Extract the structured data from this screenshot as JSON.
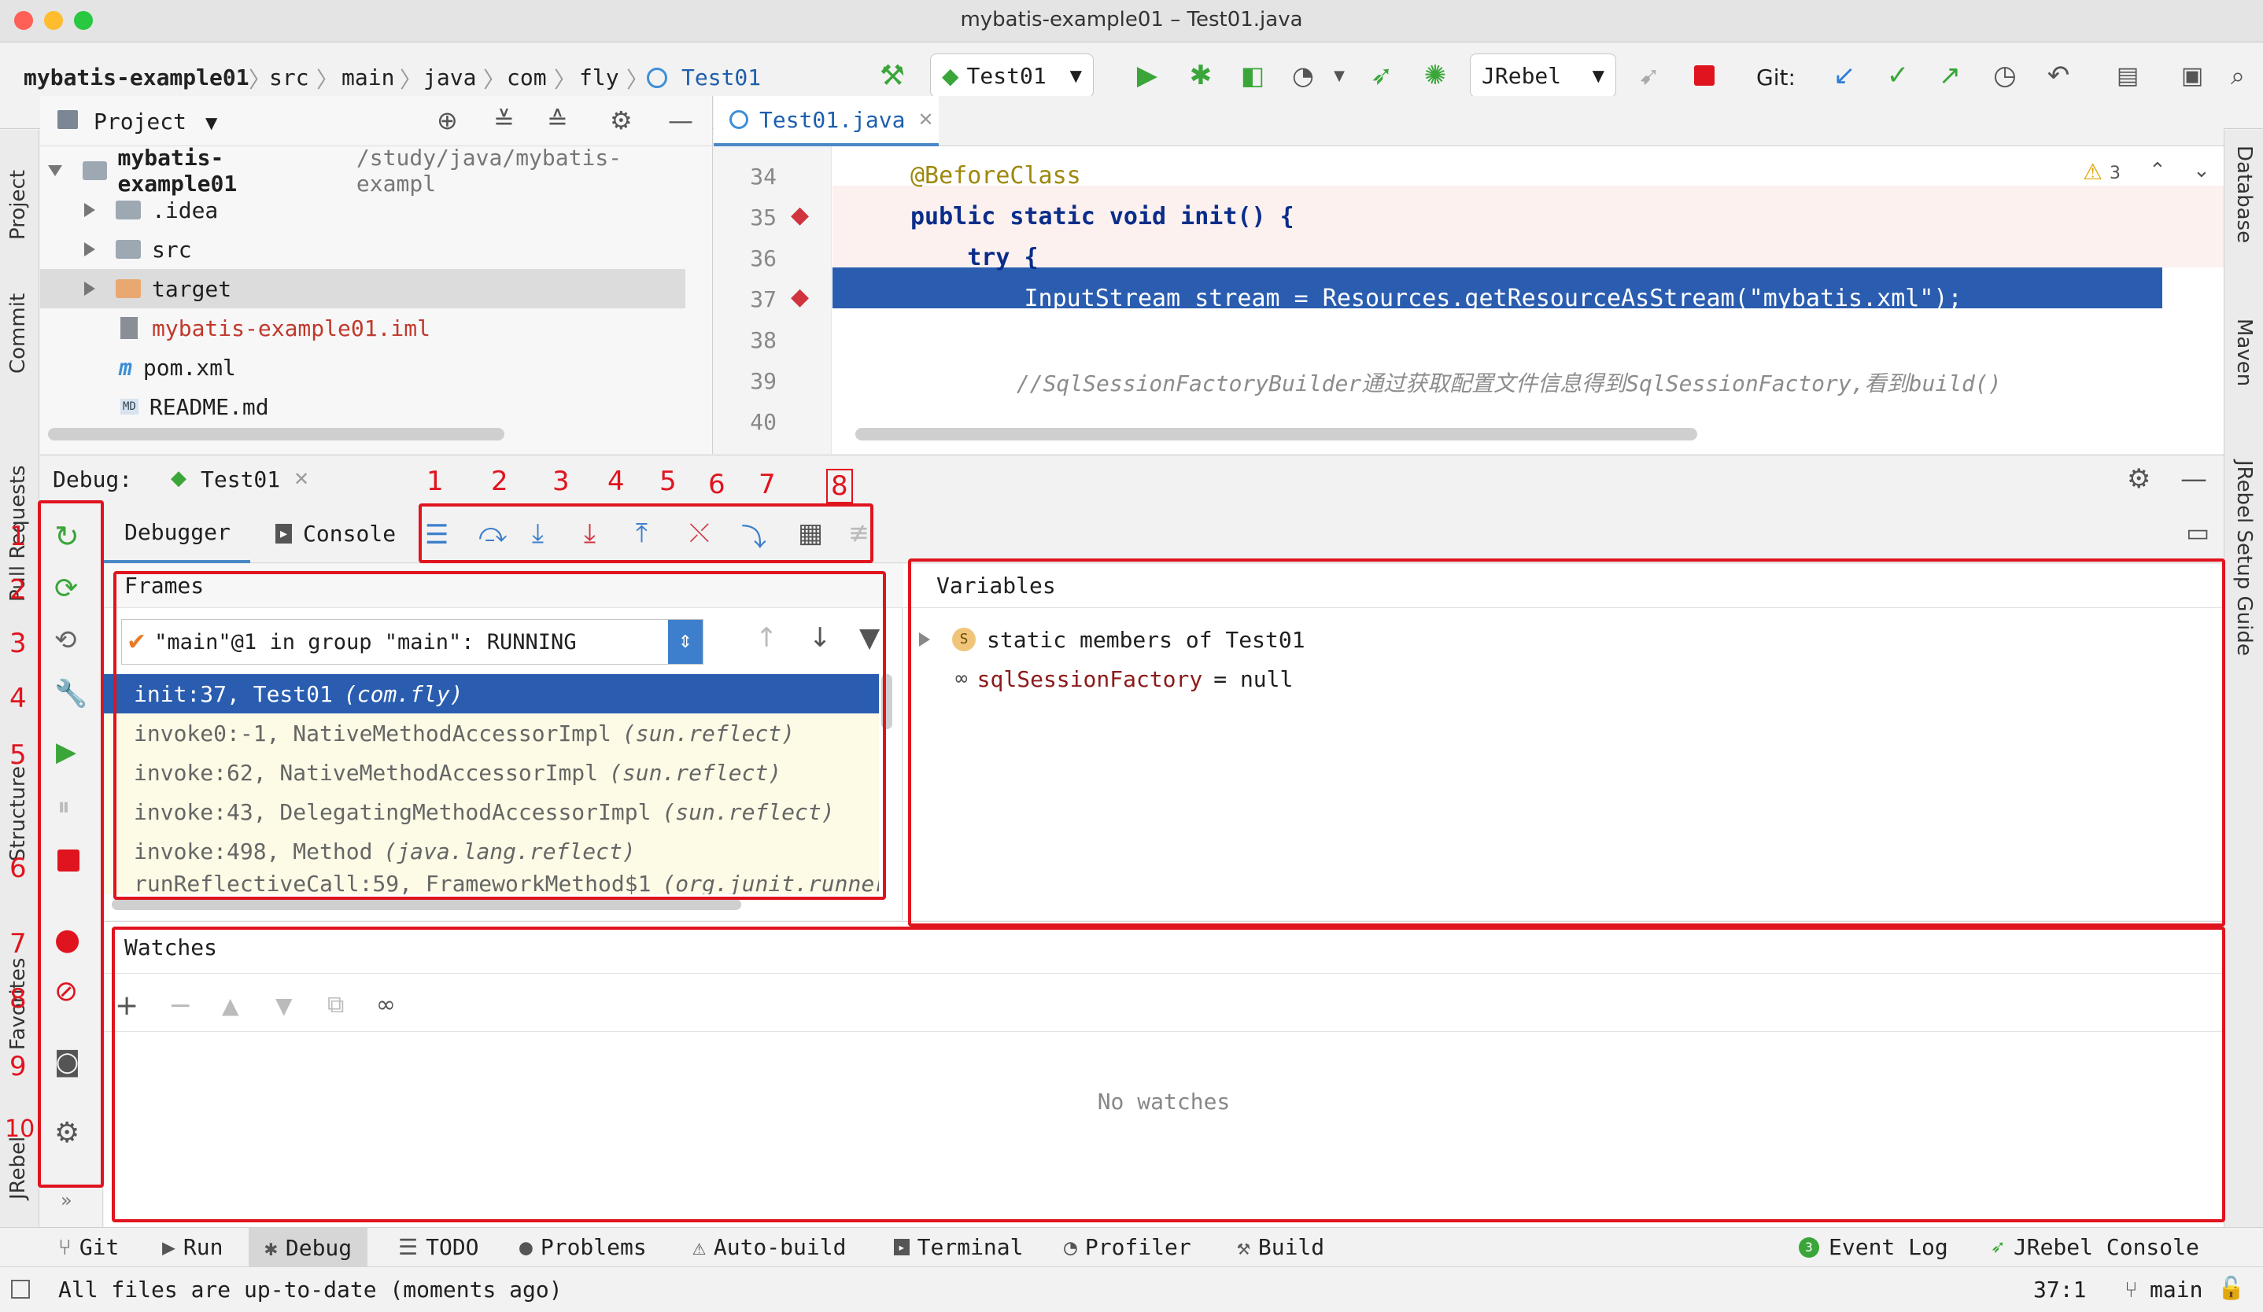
{
  "window": {
    "title": "mybatis-example01 – Test01.java"
  },
  "breadcrumbs": [
    "mybatis-example01",
    "src",
    "main",
    "java",
    "com",
    "fly",
    "Test01"
  ],
  "toolbar": {
    "run_config": "Test01",
    "jrebel": "JRebel",
    "git_label": "Git:"
  },
  "left_stripe": {
    "project": "Project",
    "commit": "Commit",
    "pull_requests": "Pull Requests",
    "structure": "Structure",
    "favorites": "Favorites",
    "jrebel": "JRebel"
  },
  "right_stripe": {
    "database": "Database",
    "maven": "Maven",
    "jrebel_guide": "JRebel Setup Guide"
  },
  "project": {
    "title": "Project",
    "root": {
      "name": "mybatis-example01",
      "path": "/study/java/mybatis-exampl"
    },
    "items": [
      {
        "name": ".idea",
        "kind": "folder"
      },
      {
        "name": "src",
        "kind": "folder"
      },
      {
        "name": "target",
        "kind": "folder-excluded"
      },
      {
        "name": "mybatis-example01.iml",
        "kind": "iml"
      },
      {
        "name": "pom.xml",
        "kind": "maven"
      },
      {
        "name": "README.md",
        "kind": "md"
      }
    ]
  },
  "editor": {
    "tab": "Test01.java",
    "warnings": "3",
    "lines": [
      {
        "no": "34",
        "code": "@BeforeClass"
      },
      {
        "no": "35",
        "code": "public static void init() {"
      },
      {
        "no": "36",
        "code": "    try {"
      },
      {
        "no": "37",
        "code": "        InputStream stream = Resources.getResourceAsStream(\"mybatis.xml\");"
      },
      {
        "no": "38",
        "code": ""
      },
      {
        "no": "39",
        "code": "        //SqlSessionFactoryBuilder通过获取配置文件信息得到SqlSessionFactory,看到build()"
      },
      {
        "no": "40",
        "code": ""
      }
    ]
  },
  "debug": {
    "label": "Debug:",
    "session": "Test01",
    "tabs": {
      "debugger": "Debugger",
      "console": "Console"
    },
    "annotations": [
      "1",
      "2",
      "3",
      "4",
      "5",
      "6",
      "7",
      "8"
    ],
    "left_annotations": [
      "1",
      "2",
      "3",
      "4",
      "5",
      "6",
      "7",
      "8",
      "9",
      "10"
    ],
    "frames": {
      "title": "Frames",
      "thread": "\"main\"@1 in group \"main\": RUNNING",
      "rows": [
        {
          "method": "init:37, Test01",
          "pkg": "(com.fly)"
        },
        {
          "method": "invoke0:-1, NativeMethodAccessorImpl",
          "pkg": "(sun.reflect)"
        },
        {
          "method": "invoke:62, NativeMethodAccessorImpl",
          "pkg": "(sun.reflect)"
        },
        {
          "method": "invoke:43, DelegatingMethodAccessorImpl",
          "pkg": "(sun.reflect)"
        },
        {
          "method": "invoke:498, Method",
          "pkg": "(java.lang.reflect)"
        },
        {
          "method": "runReflectiveCall:59, FrameworkMethod$1",
          "pkg": "(org.junit.runners"
        }
      ]
    },
    "variables": {
      "title": "Variables",
      "static_members": "static members of Test01",
      "var_name": "sqlSessionFactory",
      "var_value": "= null"
    },
    "watches": {
      "title": "Watches",
      "empty": "No watches"
    }
  },
  "bottom_tabs": [
    "Git",
    "Run",
    "Debug",
    "TODO",
    "Problems",
    "Auto-build",
    "Terminal",
    "Profiler",
    "Build"
  ],
  "bottom_right": {
    "event_log": "Event Log",
    "event_count": "3",
    "jrebel_console": "JRebel Console"
  },
  "status": {
    "message": "All files are up-to-date (moments ago)",
    "position": "37:1",
    "branch": "main"
  },
  "colors": {
    "selection": "#2a5db0",
    "annotation_red": "#e0141e",
    "run_green": "#3aa63a"
  }
}
